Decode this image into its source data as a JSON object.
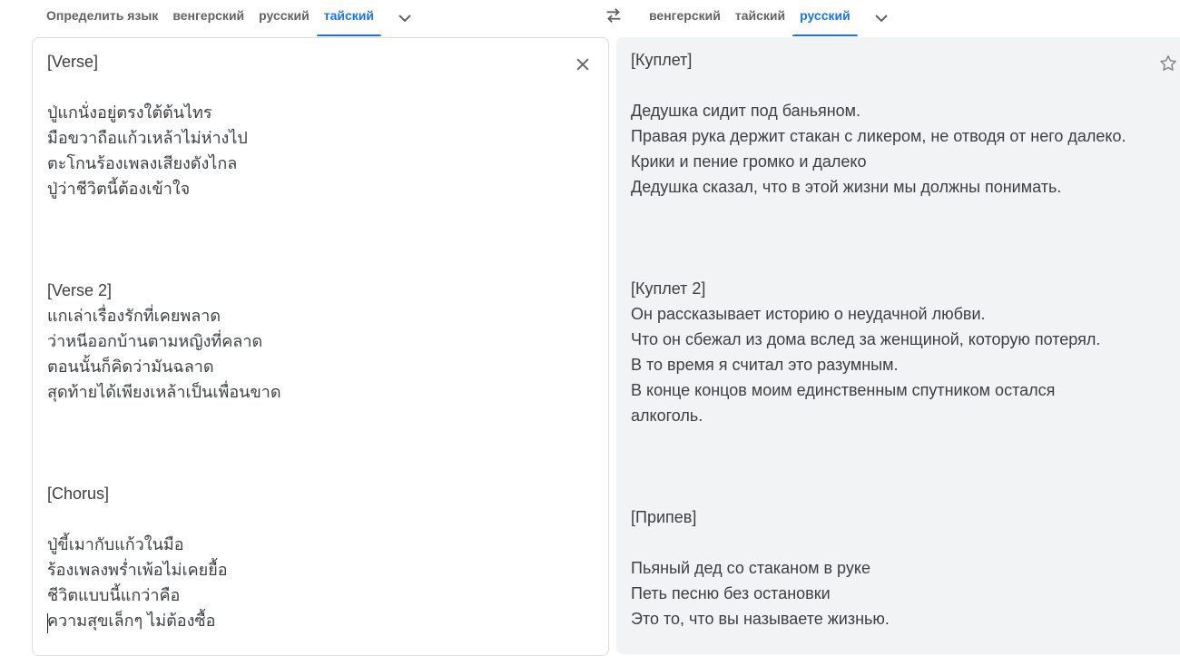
{
  "source_langs": {
    "tabs": [
      "Определить язык",
      "венгерский",
      "русский",
      "тайский"
    ],
    "active_index": 3
  },
  "target_langs": {
    "tabs": [
      "венгерский",
      "тайский",
      "русский"
    ],
    "active_index": 2
  },
  "icons": {
    "swap": "swap-arrows-icon",
    "more_langs": "chevron-down-icon",
    "clear": "close-icon",
    "save": "star-icon"
  },
  "colors": {
    "accent": "#1a73e8",
    "text": "#3c4043",
    "muted": "#5f6368",
    "target_bg": "#f1f3f4"
  },
  "source_text": "[Verse]\n\nปู่แกนั่งอยู่ตรงใต้ต้นไทร\nมือขวาถือแก้วเหล้าไม่ห่างไป\nตะโกนร้องเพลงเสียงดังไกล\nปู่ว่าชีวิตนี้ต้องเข้าใจ\n\n\n\n[Verse 2]\nแกเล่าเรื่องรักที่เคยพลาด\nว่าหนีออกบ้านตามหญิงที่คลาด\nตอนนั้นก็คิดว่ามันฉลาด\nสุดท้ายได้เพียงเหล้าเป็นเพื่อนขาด\n\n\n\n[Chorus]\n\nปู่ขี้เมากับแก้วในมือ\nร้องเพลงพร่ำเพ้อไม่เคยยื้อ\nชีวิตแบบนี้แกว่าคือ\nความสุขเล็กๆ ไม่ต้องซื้อ",
  "translation_text": "[Куплет]\n\nДедушка сидит под баньяном.\nПравая рука держит стакан с ликером, не отводя от него далеко.\nКрики и пение громко и далеко\nДедушка сказал, что в этой жизни мы должны понимать.\n\n\n\n[Куплет 2]\nОн рассказывает историю о неудачной любви.\nЧто он сбежал из дома вслед за женщиной, которую потерял.\nВ то время я считал это разумным.\nВ конце концов моим единственным спутником остался\nалкоголь.\n\n\n\n[Припев]\n\nПьяный дед со стаканом в руке\nПеть песню без остановки\nЭто то, что вы называете жизнью."
}
